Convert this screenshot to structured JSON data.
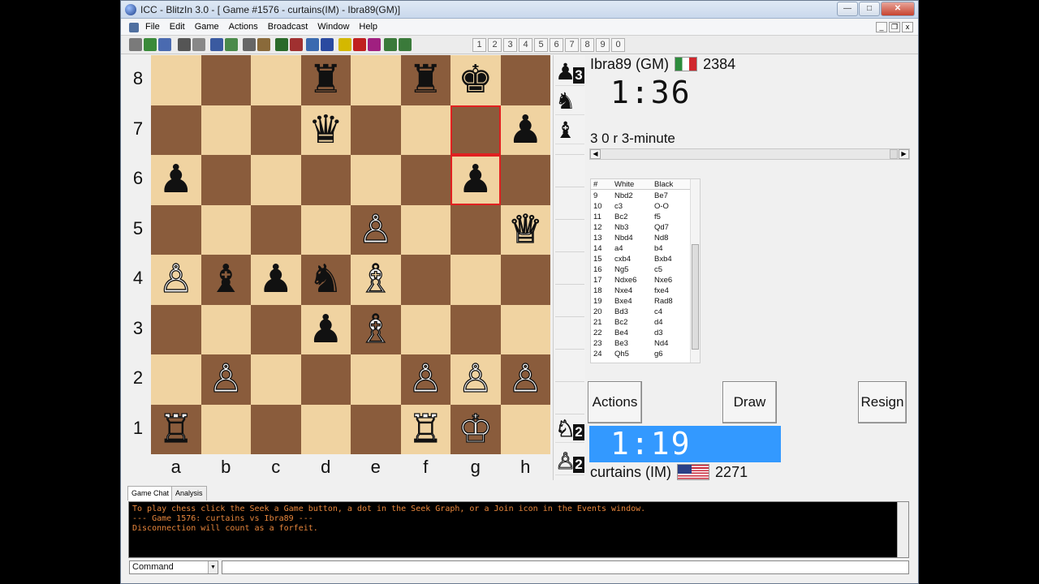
{
  "window": {
    "title": "ICC - BlitzIn 3.0 - [ Game #1576 - curtains(IM) - Ibra89(GM)]"
  },
  "menu": {
    "items": [
      "File",
      "Edit",
      "Game",
      "Actions",
      "Broadcast",
      "Window",
      "Help"
    ]
  },
  "toolbar": {
    "numbers": [
      "1",
      "2",
      "3",
      "4",
      "5",
      "6",
      "7",
      "8",
      "9",
      "0"
    ],
    "icons": [
      "new-board-icon",
      "open-icon",
      "save-icon",
      "print-icon",
      "copy-icon",
      "seek-icon",
      "graph-icon",
      "console-icon",
      "events-icon",
      "people-icon",
      "observe-icon",
      "examine-icon",
      "help-icon",
      "finger-icon",
      "game1-icon",
      "game2-icon",
      "game3-icon",
      "game4-icon"
    ]
  },
  "board": {
    "ranks": [
      "8",
      "7",
      "6",
      "5",
      "4",
      "3",
      "2",
      "1"
    ],
    "files": [
      "a",
      "b",
      "c",
      "d",
      "e",
      "f",
      "g",
      "h"
    ],
    "highlight": [
      "g7",
      "g6"
    ],
    "pieces": [
      {
        "sq": "d8",
        "glyph": "♜",
        "color": "b",
        "name": "black-rook"
      },
      {
        "sq": "f8",
        "glyph": "♜",
        "color": "b",
        "name": "black-rook"
      },
      {
        "sq": "g8",
        "glyph": "♚",
        "color": "b",
        "name": "black-king"
      },
      {
        "sq": "d7",
        "glyph": "♛",
        "color": "b",
        "name": "black-queen"
      },
      {
        "sq": "h7",
        "glyph": "♟",
        "color": "b",
        "name": "black-pawn"
      },
      {
        "sq": "a6",
        "glyph": "♟",
        "color": "b",
        "name": "black-pawn"
      },
      {
        "sq": "g6",
        "glyph": "♟",
        "color": "b",
        "name": "black-pawn"
      },
      {
        "sq": "e5",
        "glyph": "♙",
        "color": "w",
        "name": "white-pawn"
      },
      {
        "sq": "h5",
        "glyph": "♕",
        "color": "w",
        "name": "white-queen"
      },
      {
        "sq": "a4",
        "glyph": "♙",
        "color": "w",
        "name": "white-pawn"
      },
      {
        "sq": "b4",
        "glyph": "♝",
        "color": "b",
        "name": "black-bishop"
      },
      {
        "sq": "c4",
        "glyph": "♟",
        "color": "b",
        "name": "black-pawn"
      },
      {
        "sq": "d4",
        "glyph": "♞",
        "color": "b",
        "name": "black-knight"
      },
      {
        "sq": "e4",
        "glyph": "♗",
        "color": "w",
        "name": "white-bishop"
      },
      {
        "sq": "d3",
        "glyph": "♟",
        "color": "b",
        "name": "black-pawn"
      },
      {
        "sq": "e3",
        "glyph": "♗",
        "color": "w",
        "name": "white-bishop"
      },
      {
        "sq": "b2",
        "glyph": "♙",
        "color": "w",
        "name": "white-pawn"
      },
      {
        "sq": "f2",
        "glyph": "♙",
        "color": "w",
        "name": "white-pawn"
      },
      {
        "sq": "g2",
        "glyph": "♙",
        "color": "w",
        "name": "white-pawn"
      },
      {
        "sq": "h2",
        "glyph": "♙",
        "color": "w",
        "name": "white-pawn"
      },
      {
        "sq": "a1",
        "glyph": "♖",
        "color": "w",
        "name": "white-rook"
      },
      {
        "sq": "f1",
        "glyph": "♖",
        "color": "w",
        "name": "white-rook"
      },
      {
        "sq": "g1",
        "glyph": "♔",
        "color": "w",
        "name": "white-king"
      }
    ]
  },
  "captured": {
    "top": [
      {
        "glyph": "♟",
        "color": "b",
        "count": "3",
        "name": "captured-black-pawn"
      },
      {
        "glyph": "♞",
        "color": "b",
        "count": "",
        "name": "captured-black-knight"
      },
      {
        "glyph": "♝",
        "color": "b",
        "count": "",
        "name": "captured-black-bishop"
      }
    ],
    "bottom": [
      {
        "glyph": "♘",
        "color": "w",
        "count": "2",
        "name": "captured-white-knight"
      },
      {
        "glyph": "♙",
        "color": "w",
        "count": "2",
        "name": "captured-white-pawn"
      }
    ]
  },
  "players": {
    "top": {
      "name": "Ibra89 (GM)",
      "rating": "2384",
      "clock": "1:36",
      "flag": "italy-flag-icon"
    },
    "bottom": {
      "name": "curtains (IM)",
      "rating": "2271",
      "clock": "1:19",
      "flag": "usa-flag-icon"
    }
  },
  "game_info": "3 0 r 3-minute",
  "moves": {
    "headers": [
      "#",
      "White",
      "Black"
    ],
    "rows": [
      [
        "9",
        "Nbd2",
        "Be7"
      ],
      [
        "10",
        "c3",
        "O-O"
      ],
      [
        "11",
        "Bc2",
        "f5"
      ],
      [
        "12",
        "Nb3",
        "Qd7"
      ],
      [
        "13",
        "Nbd4",
        "Nd8"
      ],
      [
        "14",
        "a4",
        "b4"
      ],
      [
        "15",
        "cxb4",
        "Bxb4"
      ],
      [
        "16",
        "Ng5",
        "c5"
      ],
      [
        "17",
        "Ndxe6",
        "Nxe6"
      ],
      [
        "18",
        "Nxe4",
        "fxe4"
      ],
      [
        "19",
        "Bxe4",
        "Rad8"
      ],
      [
        "20",
        "Bd3",
        "c4"
      ],
      [
        "21",
        "Bc2",
        "d4"
      ],
      [
        "22",
        "Be4",
        "d3"
      ],
      [
        "23",
        "Be3",
        "Nd4"
      ],
      [
        "24",
        "Qh5",
        "g6"
      ]
    ]
  },
  "buttons": {
    "actions": "Actions",
    "draw": "Draw",
    "resign": "Resign"
  },
  "chat": {
    "tabs": [
      "Game Chat",
      "Analysis"
    ],
    "lines": [
      "To play chess click the Seek a Game button, a dot in the Seek Graph, or a Join icon in the Events window.",
      "--- Game 1576: curtains vs Ibra89 ---",
      "Disconnection will count as a forfeit."
    ],
    "command_select": "Command"
  },
  "colors": {
    "light_square": "#f0d3a1",
    "dark_square": "#8a5c3c",
    "active_clock": "#3399ff",
    "chat_text": "#e8863c",
    "highlight": "#e02020"
  }
}
